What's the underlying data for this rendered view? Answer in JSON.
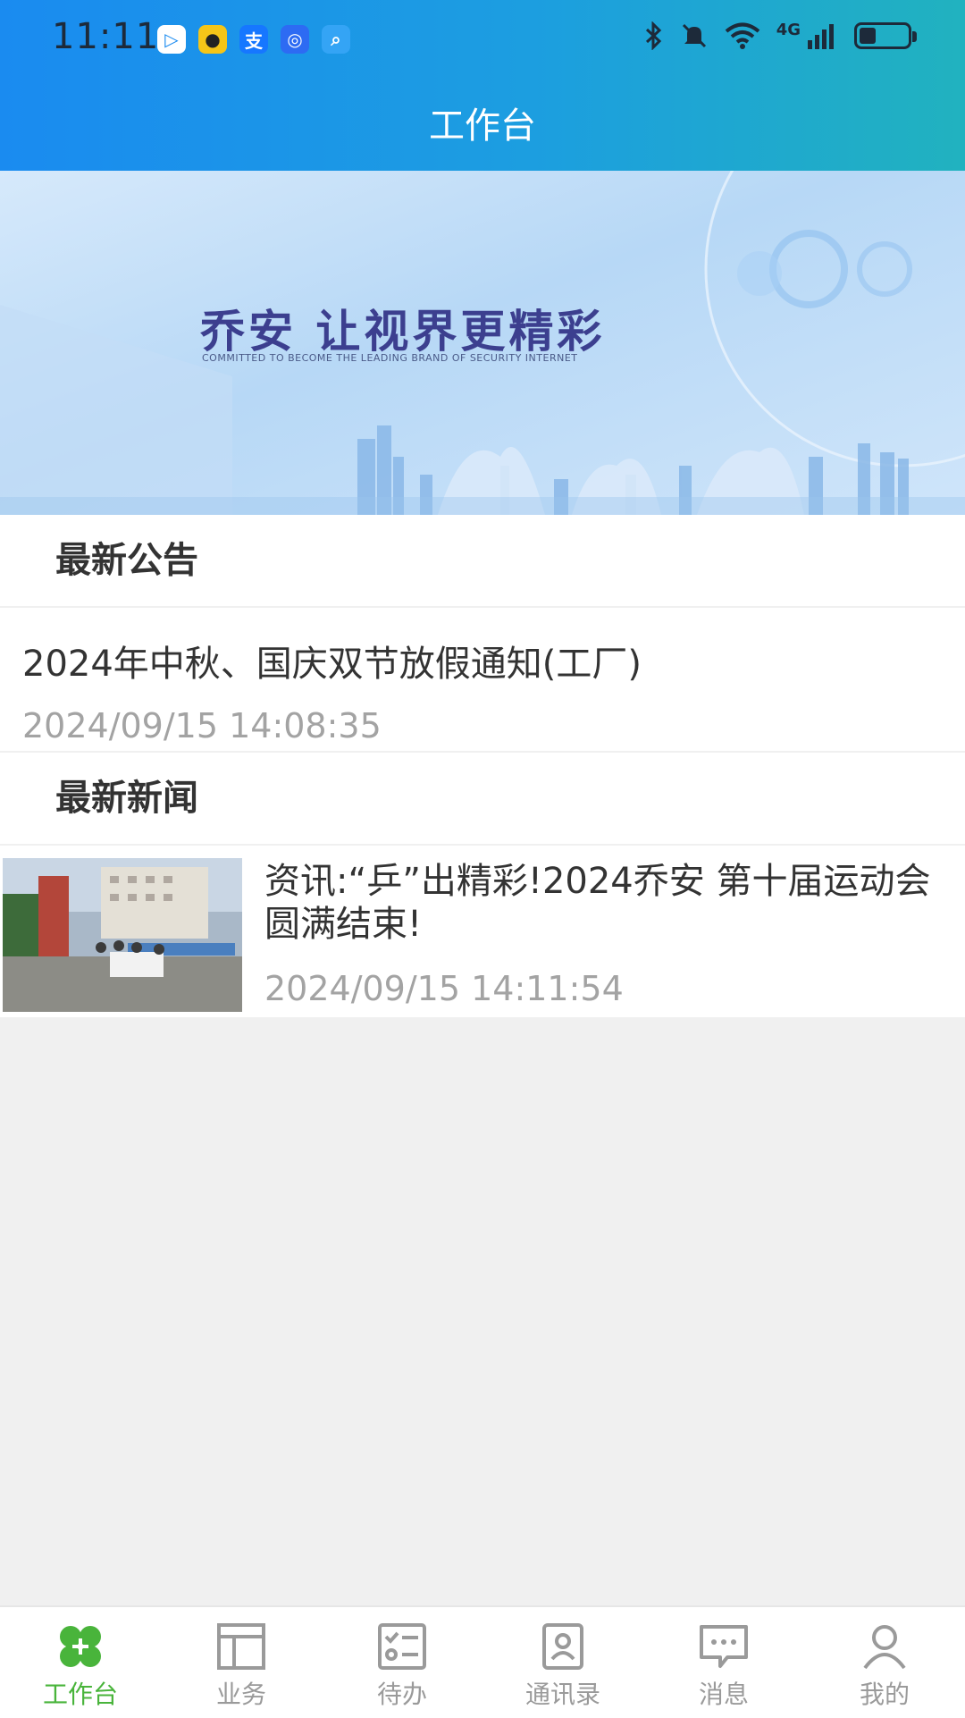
{
  "status_bar": {
    "time": "11:11",
    "network": "4G"
  },
  "header": {
    "title": "工作台"
  },
  "banner": {
    "headline": "乔安 让视界更精彩",
    "subtitle": "COMMITTED TO BECOME THE LEADING BRAND OF SECURITY INTERNET"
  },
  "announcements": {
    "heading": "最新公告",
    "items": [
      {
        "title": "2024年中秋、国庆双节放假通知(工厂)",
        "date": "2024/09/15 14:08:35"
      }
    ]
  },
  "news": {
    "heading": "最新新闻",
    "items": [
      {
        "title": "资讯:“乒”出精彩!2024乔安 第十届运动会圆满结束!",
        "date": "2024/09/15 14:11:54"
      }
    ]
  },
  "tabbar": {
    "items": [
      {
        "label": "工作台",
        "icon": "workbench-icon",
        "active": true
      },
      {
        "label": "业务",
        "icon": "business-icon",
        "active": false
      },
      {
        "label": "待办",
        "icon": "todo-icon",
        "active": false
      },
      {
        "label": "通讯录",
        "icon": "contacts-icon",
        "active": false
      },
      {
        "label": "消息",
        "icon": "message-icon",
        "active": false
      },
      {
        "label": "我的",
        "icon": "profile-icon",
        "active": false
      }
    ]
  },
  "colors": {
    "active_tab": "#49b43b",
    "inactive_tab": "#9a9a9a",
    "header_start": "#1a8bf0",
    "header_end": "#21b2bf"
  }
}
